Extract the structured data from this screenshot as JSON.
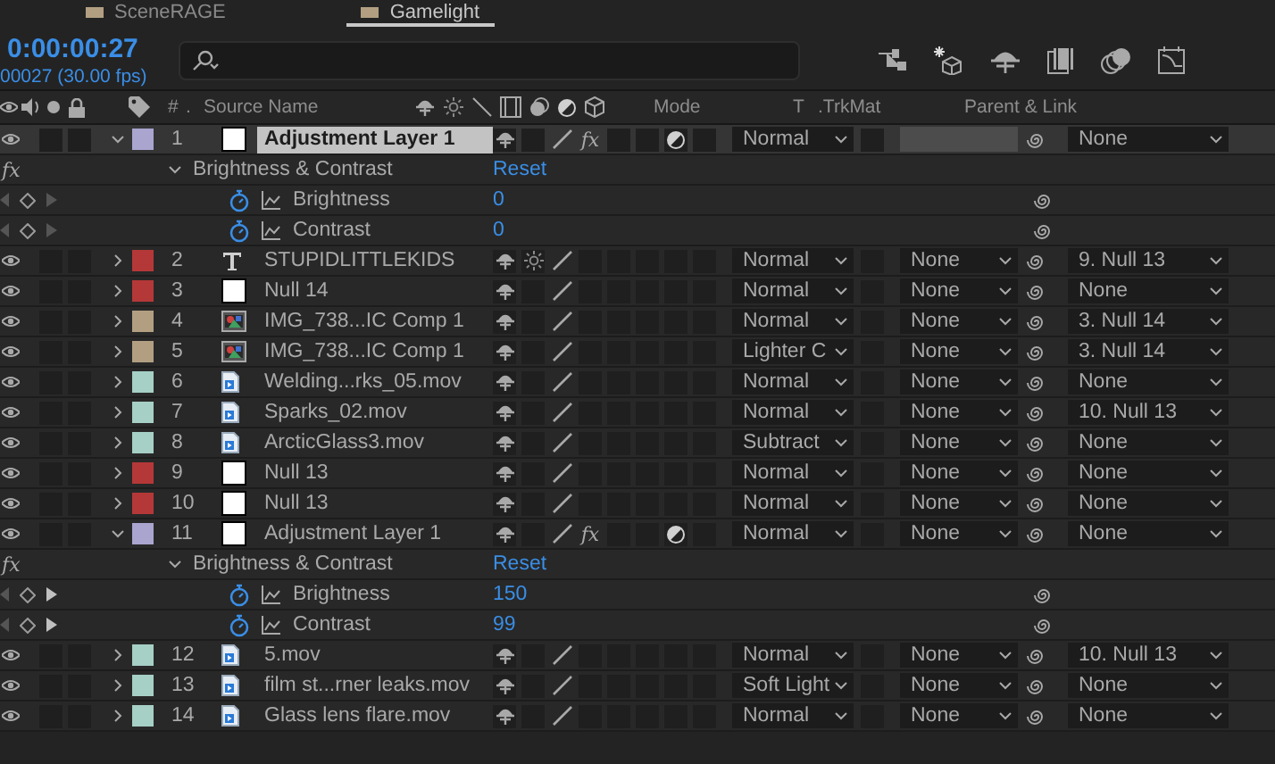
{
  "tabs": [
    {
      "label": "SceneRAGE",
      "selected": false
    },
    {
      "label": "Gamelight",
      "selected": true
    }
  ],
  "timecode": "0:00:00:27",
  "frame_info": "00027 (30.00 fps)",
  "columns": {
    "number": "#",
    "number_sort": ".",
    "source_name": "Source Name",
    "mode": "Mode",
    "t": "T",
    "trkmat": ".TrkMat",
    "parent": "Parent & Link"
  },
  "layers": [
    {
      "index": "1",
      "name": "Adjustment Layer 1",
      "color": "#a9a5cf",
      "kind": "solid",
      "selected": true,
      "expanded": true,
      "collapse": false,
      "fx": "fx",
      "adjustment": true,
      "mode": "Normal",
      "parent": "None",
      "effects": [
        {
          "badge": "fx",
          "name": "Brightness & Contrast",
          "reset": "Reset",
          "expanded": true,
          "properties": [
            {
              "name": "Brightness",
              "value": "0",
              "next_keyframe": false
            },
            {
              "name": "Contrast",
              "value": "0",
              "next_keyframe": false
            }
          ]
        }
      ]
    },
    {
      "index": "2",
      "name": "STUPIDLITTLEKIDS",
      "color": "#b53838",
      "kind": "text",
      "selected": false,
      "expanded": false,
      "collapse": true,
      "adjustment": false,
      "mode": "Normal",
      "trkmat": "None",
      "parent": "9. Null 13"
    },
    {
      "index": "3",
      "name": "Null 14",
      "color": "#b53838",
      "kind": "solid",
      "selected": false,
      "expanded": false,
      "collapse": false,
      "adjustment": false,
      "mode": "Normal",
      "trkmat": "None",
      "parent": "None"
    },
    {
      "index": "4",
      "name": "IMG_738...IC Comp 1",
      "color": "#b29f82",
      "kind": "comp",
      "selected": false,
      "expanded": false,
      "collapse": false,
      "adjustment": false,
      "mode": "Normal",
      "trkmat": "None",
      "parent": "3. Null 14"
    },
    {
      "index": "5",
      "name": "IMG_738...IC Comp 1",
      "color": "#b29f82",
      "kind": "comp",
      "selected": false,
      "expanded": false,
      "collapse": false,
      "adjustment": false,
      "mode": "Lighter C",
      "trkmat": "None",
      "parent": "3. Null 14"
    },
    {
      "index": "6",
      "name": "Welding...rks_05.mov",
      "color": "#a6cfc6",
      "kind": "footage",
      "selected": false,
      "expanded": false,
      "collapse": false,
      "adjustment": false,
      "mode": "Normal",
      "trkmat": "None",
      "parent": "None"
    },
    {
      "index": "7",
      "name": "Sparks_02.mov",
      "color": "#a6cfc6",
      "kind": "footage",
      "selected": false,
      "expanded": false,
      "collapse": false,
      "adjustment": false,
      "mode": "Normal",
      "trkmat": "None",
      "parent": "10. Null 13"
    },
    {
      "index": "8",
      "name": "ArcticGlass3.mov",
      "color": "#a6cfc6",
      "kind": "footage",
      "selected": false,
      "expanded": false,
      "collapse": false,
      "adjustment": false,
      "mode": "Subtract",
      "trkmat": "None",
      "parent": "None"
    },
    {
      "index": "9",
      "name": "Null 13",
      "color": "#b53838",
      "kind": "solid",
      "selected": false,
      "expanded": false,
      "collapse": false,
      "adjustment": false,
      "mode": "Normal",
      "trkmat": "None",
      "parent": "None"
    },
    {
      "index": "10",
      "name": "Null 13",
      "color": "#b53838",
      "kind": "solid",
      "selected": false,
      "expanded": false,
      "collapse": false,
      "adjustment": false,
      "mode": "Normal",
      "trkmat": "None",
      "parent": "None"
    },
    {
      "index": "11",
      "name": "Adjustment Layer 1",
      "color": "#a9a5cf",
      "kind": "solid",
      "selected": false,
      "expanded": true,
      "collapse": false,
      "fx": "fx",
      "adjustment": true,
      "mode": "Normal",
      "trkmat": "None",
      "parent": "None",
      "effects": [
        {
          "badge": "fx",
          "name": "Brightness & Contrast",
          "reset": "Reset",
          "expanded": true,
          "properties": [
            {
              "name": "Brightness",
              "value": "150",
              "next_keyframe": true
            },
            {
              "name": "Contrast",
              "value": "99",
              "next_keyframe": true
            }
          ]
        }
      ]
    },
    {
      "index": "12",
      "name": "5.mov",
      "color": "#a6cfc6",
      "kind": "footage",
      "selected": false,
      "expanded": false,
      "collapse": false,
      "adjustment": false,
      "mode": "Normal",
      "trkmat": "None",
      "parent": "10. Null 13"
    },
    {
      "index": "13",
      "name": "film st...rner leaks.mov",
      "color": "#a6cfc6",
      "kind": "footage",
      "selected": false,
      "expanded": false,
      "collapse": false,
      "adjustment": false,
      "mode": "Soft Light",
      "trkmat": "None",
      "parent": "None"
    },
    {
      "index": "14",
      "name": "Glass lens flare.mov",
      "color": "#a6cfc6",
      "kind": "footage",
      "selected": false,
      "expanded": false,
      "collapse": false,
      "adjustment": false,
      "mode": "Normal",
      "trkmat": "None",
      "parent": "None"
    }
  ]
}
